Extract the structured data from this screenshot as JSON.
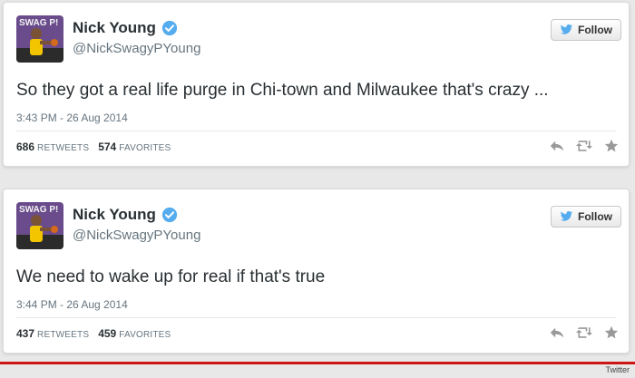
{
  "tweets": [
    {
      "name": "Nick Young",
      "handle": "@NickSwagyPYoung",
      "follow_label": "Follow",
      "text": "So they got a real life purge in Chi-town and Milwaukee that's crazy ...",
      "time": "3:43 PM - 26 Aug 2014",
      "retweets_count": "686",
      "retweets_label": "RETWEETS",
      "favorites_count": "574",
      "favorites_label": "FAVORITES",
      "avatar_text": "SWAG P!"
    },
    {
      "name": "Nick Young",
      "handle": "@NickSwagyPYoung",
      "follow_label": "Follow",
      "text": "We need to wake up for real if that's true",
      "time": "3:44 PM - 26 Aug 2014",
      "retweets_count": "437",
      "retweets_label": "RETWEETS",
      "favorites_count": "459",
      "favorites_label": "FAVORITES",
      "avatar_text": "SWAG P!"
    }
  ],
  "source_credit": "Twitter",
  "colors": {
    "verified": "#55acee",
    "twitter_bird": "#55acee",
    "accent_line": "#cc1515",
    "avatar_jersey": "#f2c500",
    "avatar_bg": "#6a4c8c"
  }
}
